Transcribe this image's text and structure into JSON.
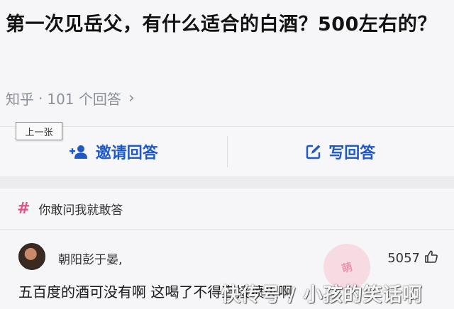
{
  "question": {
    "title": "第一次见岳父，有什么适合的白酒？500左右的？",
    "source": "知乎",
    "dot": "·",
    "answer_count": "101 个回答",
    "chevron": "›"
  },
  "tooltip": "上一张",
  "actions": {
    "invite": {
      "label": "邀请回答",
      "icon": "add-person-icon"
    },
    "write": {
      "label": "写回答",
      "icon": "edit-icon"
    }
  },
  "topic": {
    "symbol": "#",
    "label": "你敢问我就敢答"
  },
  "answer": {
    "author": "朝阳彭于晏,",
    "votes": "5057",
    "text": "五百度的酒可没有啊  这喝了不得直接喷火啊"
  },
  "watermark": {
    "seal": "萌",
    "text": "快传号 / 小孩的笑话啊"
  },
  "colors": {
    "accent": "#1f59c7",
    "topic_hash": "#e0548a",
    "meta": "#8a8f99"
  }
}
